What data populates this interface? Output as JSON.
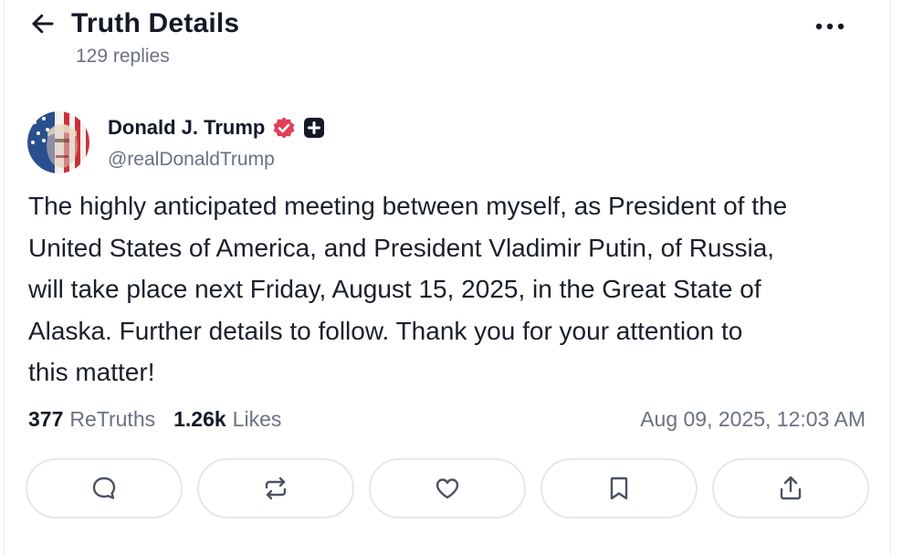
{
  "header": {
    "title": "Truth Details",
    "replies": "129 replies",
    "back_icon": "arrow-left-icon",
    "more_icon": "ellipsis-icon"
  },
  "author": {
    "name": "Donald J. Trump",
    "handle": "@realDonaldTrump",
    "verified_color": "#e23e57",
    "badge_icon": "plus-badge-icon"
  },
  "post": {
    "text": "The highly anticipated meeting between myself, as President of the\nUnited States of America, and President Vladimir Putin, of Russia,\nwill take place next Friday, August 15, 2025, in the Great State of\nAlaska. Further details to follow. Thank you for your attention to\nthis matter!"
  },
  "stats": {
    "retruths_count": "377",
    "retruths_label": "ReTruths",
    "likes_count": "1.26k",
    "likes_label": "Likes",
    "timestamp": "Aug 09, 2025, 12:03 AM"
  },
  "actions": [
    {
      "icon": "reply-icon"
    },
    {
      "icon": "retruth-icon"
    },
    {
      "icon": "like-icon"
    },
    {
      "icon": "bookmark-icon"
    },
    {
      "icon": "share-icon"
    }
  ],
  "colors": {
    "text_primary": "#141925",
    "text_secondary": "#6b7180",
    "border": "#e6e7eb",
    "icon": "#4b5261"
  }
}
